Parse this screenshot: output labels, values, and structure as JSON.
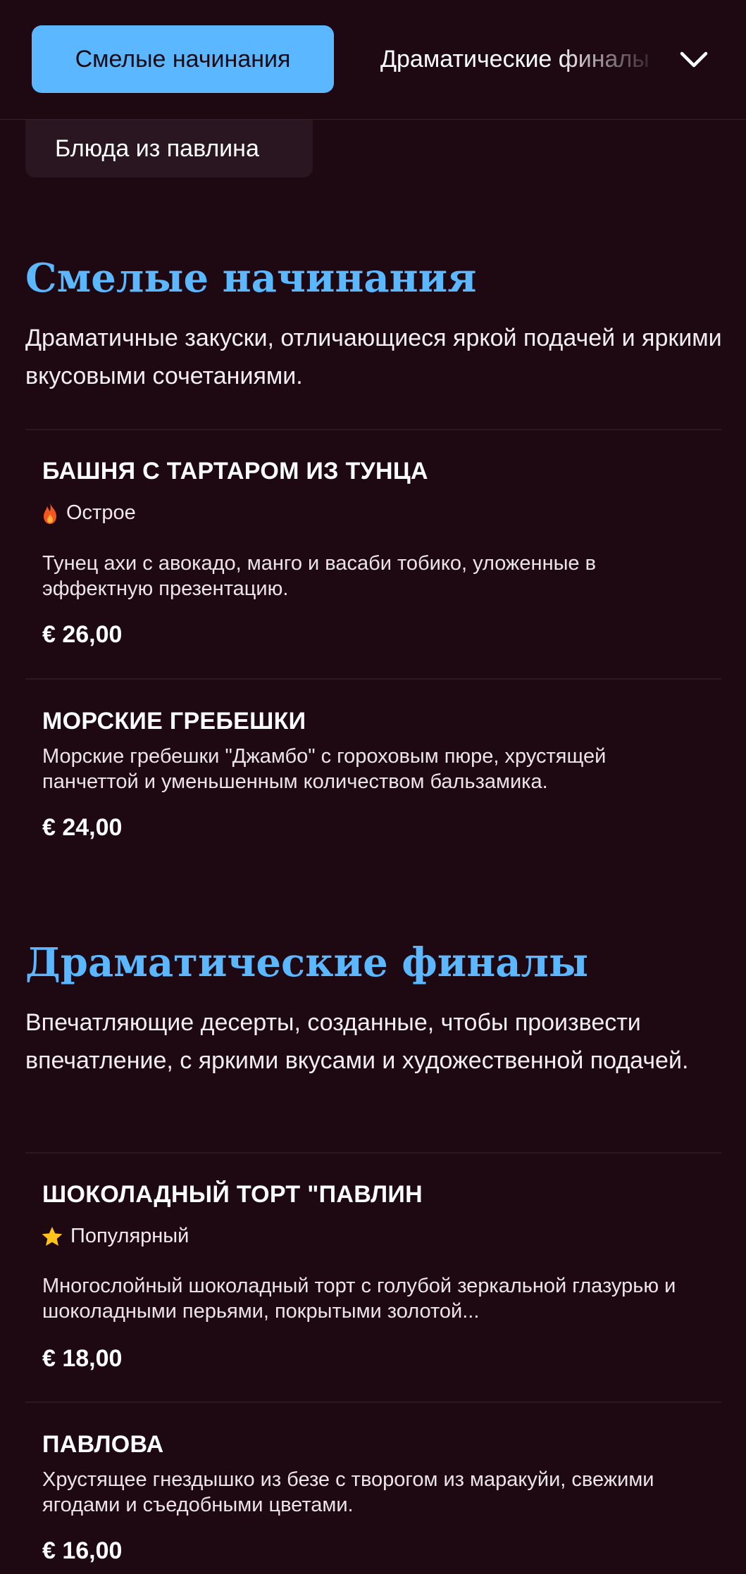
{
  "tabs": {
    "active": "Смелые начинания",
    "next": "Драматические финалы",
    "hidden": "Блюда из павлина"
  },
  "sections": [
    {
      "title": "Смелые начинания",
      "description": "Драматичные закуски, отличающиеся яркой подачей и яркими вкусовыми сочетаниями.",
      "items": [
        {
          "name": "БАШНЯ С ТАРТАРОМ ИЗ ТУНЦА",
          "badge": "Острое",
          "badge_icon": "flame-icon",
          "description": "Тунец ахи с авокадо, манго и васаби тобико, уложенные в эффектную презентацию.",
          "price": "€ 26,00"
        },
        {
          "name": "МОРСКИЕ ГРЕБЕШКИ",
          "description": "Морские гребешки \"Джамбо\" с гороховым пюре, хрустящей панчеттой и уменьшенным количеством бальзамика.",
          "price": "€ 24,00"
        }
      ]
    },
    {
      "title": "Драматические финалы",
      "description": "Впечатляющие десерты, созданные, чтобы произвести впечатление, с яркими вкусами и художественной подачей.",
      "items": [
        {
          "name": "ШОКОЛАДНЫЙ ТОРТ \"ПАВЛИН",
          "badge": "Популярный",
          "badge_icon": "star-icon",
          "description": "Многослойный шоколадный торт с голубой зеркальной глазурью и шоколадными перьями, покрытыми золотой...",
          "price": "€ 18,00"
        },
        {
          "name": "ПАВЛОВА",
          "description": "Хрустящее гнездышко из безе с творогом из маракуйи, свежими ягодами и съедобными цветами.",
          "price": "€ 16,00"
        }
      ]
    }
  ],
  "colors": {
    "background": "#1e0912",
    "accent": "#5bb7ff",
    "card": "#2a1620"
  }
}
